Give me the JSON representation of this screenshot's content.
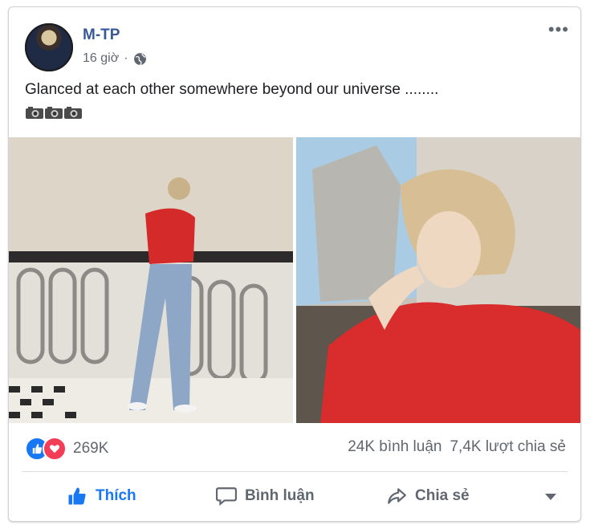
{
  "post": {
    "author": "M-TP",
    "time": "16 giờ",
    "separator": "·",
    "text": "Glanced at each other somewhere beyond our universe ........",
    "emojis": [
      "camera-icon",
      "camera-icon",
      "camera-icon"
    ]
  },
  "stats": {
    "reactions_count": "269K",
    "comments": "24K bình luận",
    "shares": "7,4K lượt chia sẻ"
  },
  "actions": {
    "like": "Thích",
    "comment": "Bình luận",
    "share": "Chia sẻ"
  },
  "colors": {
    "accent": "#1877f2",
    "name": "#385898",
    "love": "#f33e58"
  }
}
